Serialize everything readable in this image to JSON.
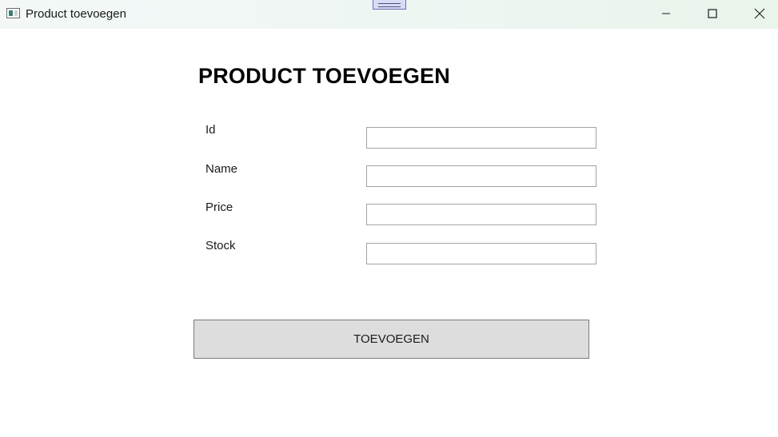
{
  "window": {
    "title": "Product toevoegen",
    "icon": "app-window-icon",
    "controls": {
      "minimize_icon": "minimize-icon",
      "maximize_icon": "maximize-icon",
      "close_icon": "close-icon"
    }
  },
  "form": {
    "heading": "PRODUCT TOEVOEGEN",
    "fields": [
      {
        "label": "Id",
        "value": "",
        "placeholder": ""
      },
      {
        "label": "Name",
        "value": "",
        "placeholder": ""
      },
      {
        "label": "Price",
        "value": "",
        "placeholder": ""
      },
      {
        "label": "Stock",
        "value": "",
        "placeholder": ""
      }
    ],
    "submit_label": "TOEVOEGEN"
  },
  "colors": {
    "button_background": "#dddddd",
    "input_border": "#a3a3a3",
    "titlebar_background": "#eef6f3"
  }
}
